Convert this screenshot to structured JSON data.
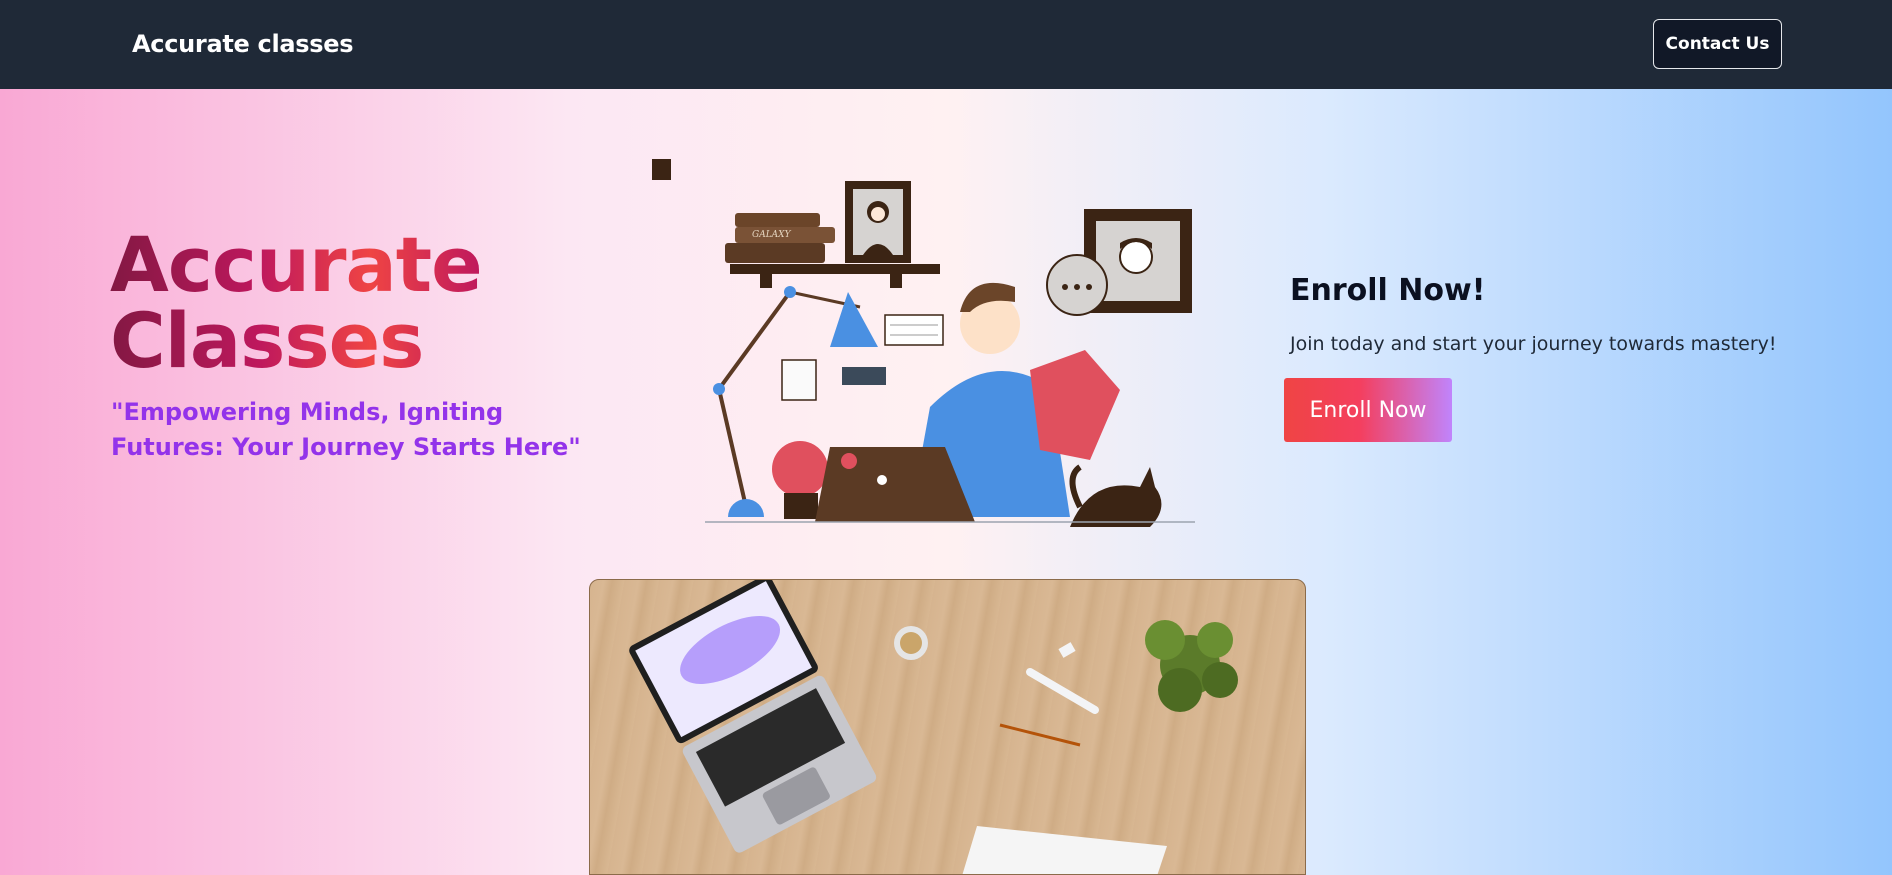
{
  "header": {
    "brand": "Accurate classes",
    "contact_label": "Contact Us"
  },
  "hero": {
    "title_line1": "Accurate",
    "title_line2": "Classes",
    "tagline": "\"Empowering Minds, Igniting Futures: Your Journey Starts Here\""
  },
  "illustration": {
    "book_label": "GALAXY"
  },
  "enroll": {
    "heading": "Enroll Now!",
    "text": "Join today and start your journey towards mastery!",
    "button_label": "Enroll Now"
  },
  "colors": {
    "navbar_bg": "#1f2937",
    "accent_pink": "#ef4444",
    "accent_purple": "#9333ea"
  }
}
